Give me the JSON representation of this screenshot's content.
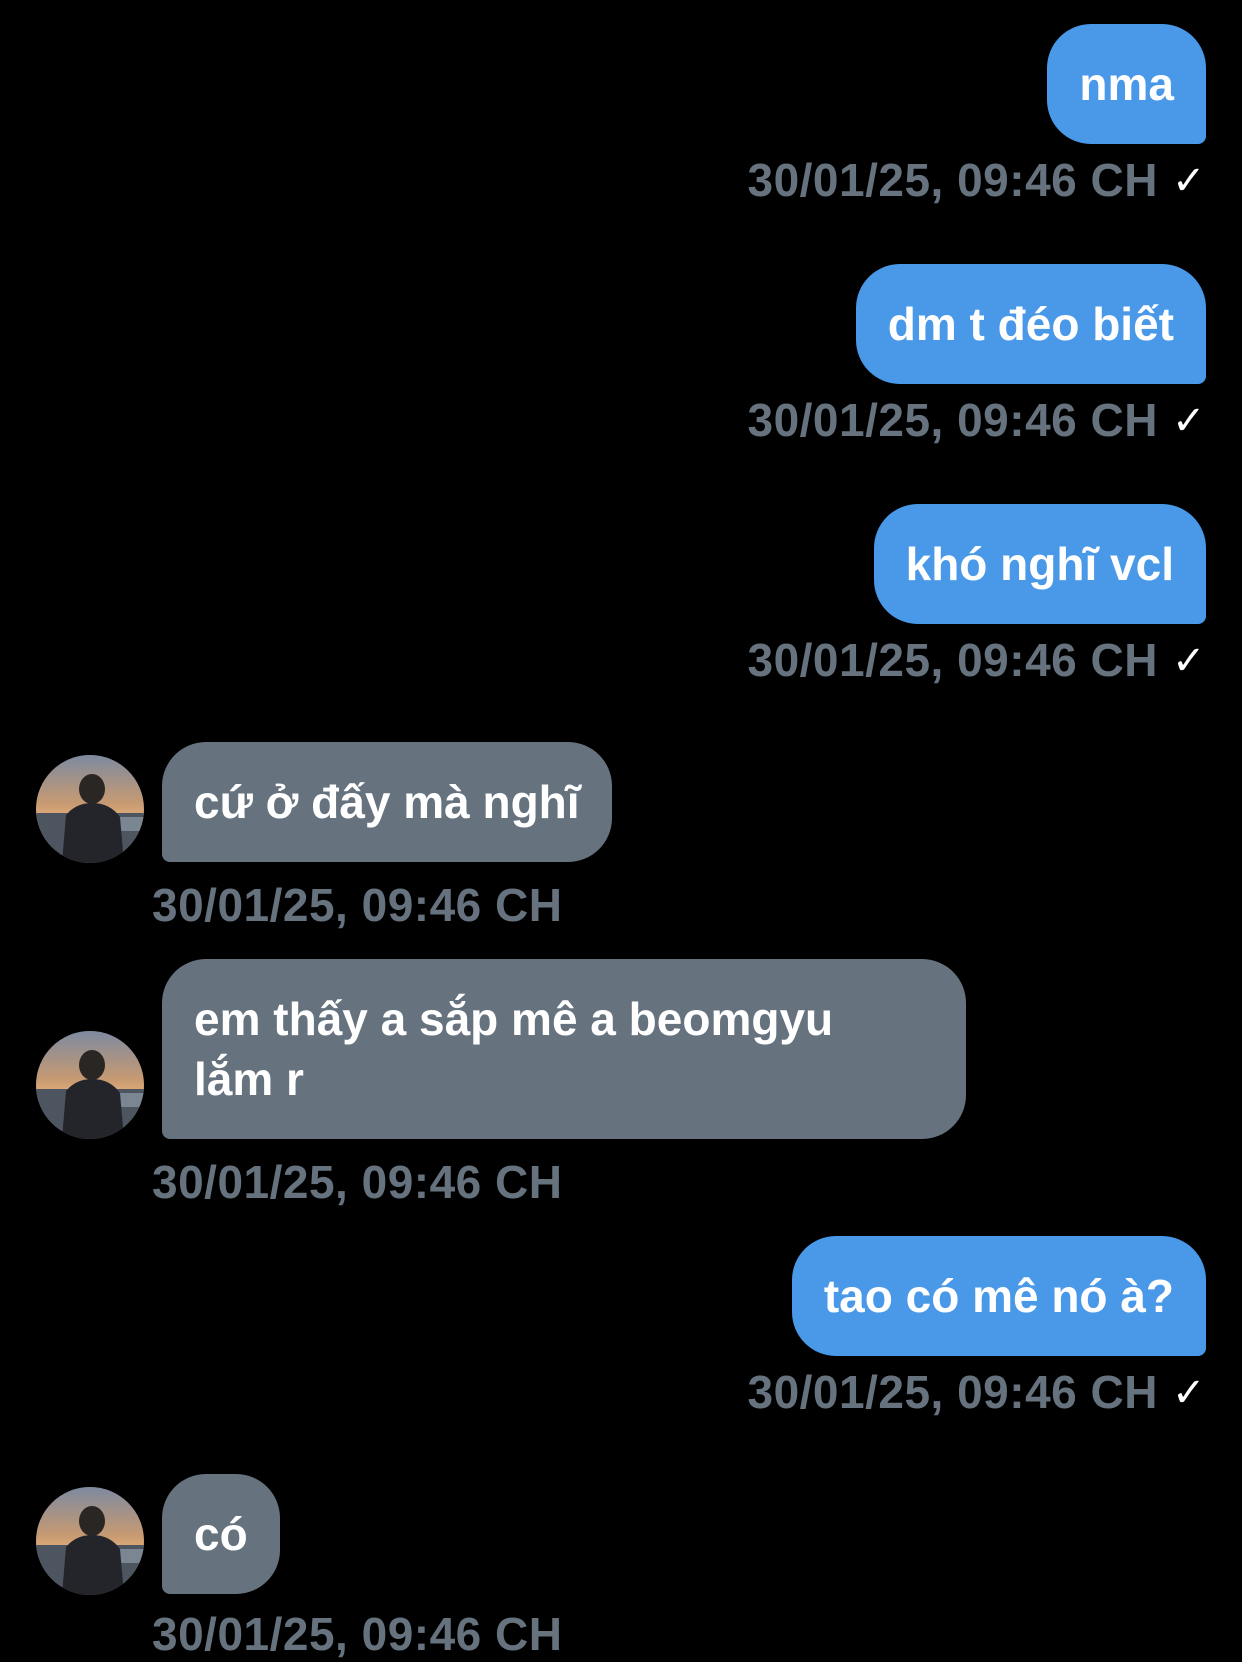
{
  "messages": [
    {
      "from": "me",
      "text": "nma",
      "time": "30/01/25, 09:46 CH"
    },
    {
      "from": "me",
      "text": "dm t đéo biết",
      "time": "30/01/25, 09:46 CH"
    },
    {
      "from": "me",
      "text": "khó nghĩ vcl",
      "time": "30/01/25, 09:46 CH"
    },
    {
      "from": "them",
      "text": "cứ ở đấy mà nghĩ",
      "time": "30/01/25, 09:46 CH"
    },
    {
      "from": "them",
      "line1": "em thấy a sắp mê a beomgyu",
      "line2": "lắm r",
      "time": "30/01/25, 09:46 CH"
    },
    {
      "from": "me",
      "text": "tao có mê nó à?",
      "time": "30/01/25, 09:46 CH"
    },
    {
      "from": "them",
      "text": "có",
      "time": "30/01/25, 09:46 CH"
    }
  ],
  "read_check": "✓",
  "icons": {
    "avatar": "contact-avatar-photo",
    "check": "check-icon"
  },
  "colors": {
    "background": "#000000",
    "sent_bubble": "#4a99e9",
    "received_bubble": "#66737f",
    "timestamp": "#66737f"
  }
}
